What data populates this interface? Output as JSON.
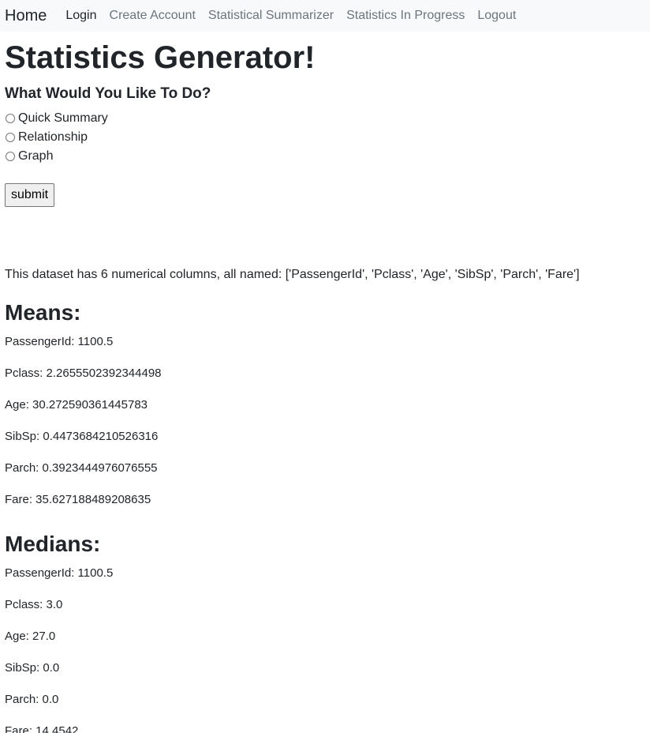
{
  "nav": {
    "brand": "Home",
    "links": [
      "Login",
      "Create Account",
      "Statistical Summarizer",
      "Statistics In Progress",
      "Logout"
    ]
  },
  "main": {
    "title": "Statistics Generator!",
    "question": "What Would You Like To Do?",
    "options": [
      "Quick Summary",
      "Relationship",
      "Graph"
    ],
    "submit_label": "submit",
    "dataset_info": "This dataset has 6 numerical columns, all named: ['PassengerId', 'Pclass', 'Age', 'SibSp', 'Parch', 'Fare']"
  },
  "means": {
    "title": "Means:",
    "items": [
      "PassengerId: 1100.5",
      "Pclass: 2.2655502392344498",
      "Age: 30.272590361445783",
      "SibSp: 0.4473684210526316",
      "Parch: 0.3923444976076555",
      "Fare: 35.627188489208635"
    ]
  },
  "medians": {
    "title": "Medians:",
    "items": [
      "PassengerId: 1100.5",
      "Pclass: 3.0",
      "Age: 27.0",
      "SibSp: 0.0",
      "Parch: 0.0",
      "Fare: 14.4542"
    ]
  }
}
